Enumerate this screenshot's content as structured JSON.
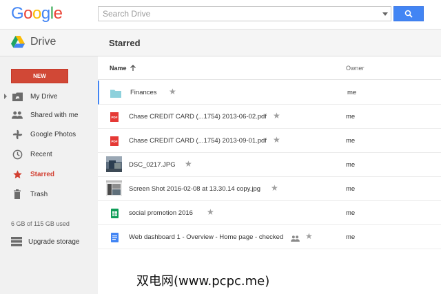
{
  "header": {
    "logo_letters": [
      {
        "ch": "G",
        "color": "#4285f4"
      },
      {
        "ch": "o",
        "color": "#ea4335"
      },
      {
        "ch": "o",
        "color": "#fbbc05"
      },
      {
        "ch": "g",
        "color": "#4285f4"
      },
      {
        "ch": "l",
        "color": "#34a853"
      },
      {
        "ch": "e",
        "color": "#ea4335"
      }
    ],
    "search_placeholder": "Search Drive",
    "search_icon": "search-icon"
  },
  "app": {
    "name": "Drive",
    "page_title": "Starred"
  },
  "sidebar": {
    "new_label": "NEW",
    "items": [
      {
        "label": "My Drive",
        "icon": "my-drive-icon",
        "active": false
      },
      {
        "label": "Shared with me",
        "icon": "people-icon",
        "active": false
      },
      {
        "label": "Google Photos",
        "icon": "photos-pinwheel-icon",
        "active": false
      },
      {
        "label": "Recent",
        "icon": "clock-icon",
        "active": false
      },
      {
        "label": "Starred",
        "icon": "star-icon",
        "active": true
      },
      {
        "label": "Trash",
        "icon": "trash-icon",
        "active": false
      }
    ],
    "quota": "6 GB of 115 GB used",
    "upgrade_label": "Upgrade storage"
  },
  "list": {
    "col_name": "Name",
    "col_owner": "Owner",
    "sort_icon": "arrow-up-icon",
    "rows": [
      {
        "name": "Finances",
        "type": "folder",
        "owner": "me",
        "shared": false
      },
      {
        "name": "Chase CREDIT CARD (...1754) 2013-06-02.pdf",
        "type": "pdf",
        "owner": "me",
        "shared": false
      },
      {
        "name": "Chase CREDIT CARD (...1754) 2013-09-01.pdf",
        "type": "pdf",
        "owner": "me",
        "shared": false
      },
      {
        "name": "DSC_0217.JPG",
        "type": "image",
        "owner": "me",
        "shared": false
      },
      {
        "name": "Screen Shot 2016-02-08 at 13.30.14 copy.jpg",
        "type": "screenshot",
        "owner": "me",
        "shared": false
      },
      {
        "name": "social promotion 2016",
        "type": "sheet",
        "owner": "me",
        "shared": false
      },
      {
        "name": "Web dashboard 1 - Overview - Home page - checked",
        "type": "doc",
        "owner": "me",
        "shared": true
      }
    ],
    "pdf_badge": "PDF"
  },
  "watermark": "双电网(www.pcpc.me)",
  "colors": {
    "accent_blue": "#4285f4",
    "new_red": "#d14836",
    "starred_red": "#d23f31"
  }
}
